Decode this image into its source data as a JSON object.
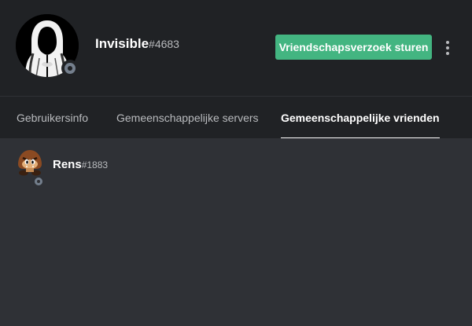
{
  "profile": {
    "username": "Invisible",
    "discriminator": "#4683",
    "status": "offline",
    "avatar_icon": "hooded-figure-avatar"
  },
  "actions": {
    "add_friend_label": "Vriendschapsverzoek sturen",
    "more_icon": "vertical-ellipsis-icon"
  },
  "tabs": [
    {
      "label": "Gebruikersinfo",
      "active": false
    },
    {
      "label": "Gemeenschappelijke servers",
      "active": false
    },
    {
      "label": "Gemeenschappelijke vrienden",
      "active": true
    }
  ],
  "mutual_friends": [
    {
      "username": "Rens",
      "discriminator": "#1883",
      "status": "offline",
      "avatar_icon": "goomba-avatar"
    }
  ],
  "colors": {
    "header_bg": "#202225",
    "body_bg": "#2f3136",
    "primary_button": "#43b581",
    "offline_status": "#747f8d",
    "active_tab_underline": "#ffffff"
  }
}
